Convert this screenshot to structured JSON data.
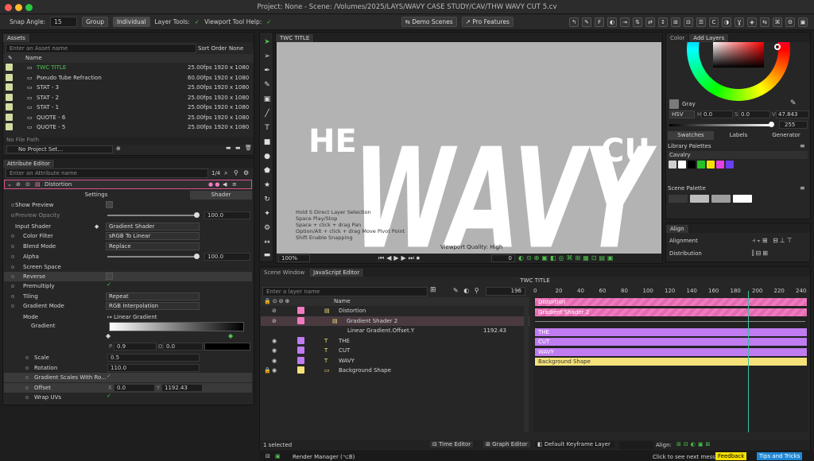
{
  "window": {
    "title": "Project: None - Scene: /Volumes/2025/LAYS/WAVY CASE STUDY/CAV/THW WAVY CUT 5.cv"
  },
  "toolbar": {
    "snap_label": "Snap Angle:",
    "snap_value": "15",
    "group": "Group",
    "individual": "Individual",
    "layer_tools": "Layer Tools:",
    "viewport_help": "Viewport Tool Help:",
    "demo_scenes": "Demo Scenes",
    "pro_features": "Pro Features"
  },
  "assets": {
    "tab": "Assets",
    "search_placeholder": "Enter an Asset name",
    "sort_label": "Sort Order",
    "sort_value": "None",
    "col_name": "Name",
    "items": [
      {
        "name": "TWC TITLE",
        "fps": "25.00fps",
        "res": "1920 x 1080"
      },
      {
        "name": "Pseudo Tube Refraction",
        "fps": "60.00fps",
        "res": "1920 x 1080"
      },
      {
        "name": "STAT - 3",
        "fps": "25.00fps",
        "res": "1920 x 1080"
      },
      {
        "name": "STAT - 2",
        "fps": "25.00fps",
        "res": "1920 x 1080"
      },
      {
        "name": "STAT - 1",
        "fps": "25.00fps",
        "res": "1920 x 1080"
      },
      {
        "name": "QUOTE - 6",
        "fps": "25.00fps",
        "res": "1920 x 1080"
      },
      {
        "name": "QUOTE - 5",
        "fps": "25.00fps",
        "res": "1920 x 1080"
      }
    ],
    "file_path": "No File Path",
    "project": "No Project Set..."
  },
  "attr": {
    "tab": "Attribute Editor",
    "search_placeholder": "Enter an Attribute name",
    "page": "1/4",
    "layer": "Distortion",
    "settings_tab": "Settings",
    "shader_tab": "Shader",
    "show_preview": "Show Preview",
    "preview_opacity": "Preview Opacity",
    "preview_opacity_val": "100.0",
    "input_shader": "Input Shader",
    "input_shader_val": "Gradient Shader",
    "color_filter": "Color Filter",
    "color_filter_val": "sRGB To Linear",
    "blend_mode": "Blend Mode",
    "blend_mode_val": "Replace",
    "alpha": "Alpha",
    "alpha_val": "100.0",
    "screen_space": "Screen Space",
    "reverse": "Reverse",
    "premultiply": "Premultiply",
    "tiling": "Tiling",
    "tiling_val": "Repeat",
    "gradient_mode": "Gradient Mode",
    "gradient_mode_val": "RGB Interpolation",
    "mode": "Mode",
    "mode_val": "Linear Gradient",
    "gradient": "Gradient",
    "p_label": "P",
    "p_val": "0.9",
    "o_label": "O",
    "o_val": "0.0",
    "scale": "Scale",
    "scale_val": "0.5",
    "rotation": "Rotation",
    "rotation_val": "110.0",
    "scales_with_ro": "Gradient Scales With Ro...",
    "offset": "Offset",
    "offset_x": "0.0",
    "offset_y": "1192.43",
    "wrap_uvs": "Wrap UVs",
    "x_label": "X",
    "y_label": "Y"
  },
  "viewport": {
    "tab": "TWC TITLE",
    "hint1": "Hold S Direct Layer Selection",
    "hint2": "Space Play/Stop",
    "hint3": "Space + click + drag Pan",
    "hint4": "Option/Alt + click + drag Move Pivot Point",
    "hint5": "Shift Enable Snapping",
    "quality": "Viewport Quality: High",
    "zoom": "100%",
    "frame": "0",
    "art_the": "HE",
    "art_wavy": "WAVY",
    "art_cut": "CU"
  },
  "color": {
    "tab_color": "Color",
    "tab_layers": "Add Layers",
    "name": "Gray",
    "mode": "HSV",
    "h": "0.0",
    "s": "0.0",
    "v": "47.843",
    "alpha": "255",
    "h_label": "H",
    "s_label": "S",
    "v_label": "V",
    "swatches": "Swatches",
    "labels": "Labels",
    "generator": "Generator",
    "library": "Library Palettes",
    "cavalry": "Cavalry",
    "scene_palette": "Scene Palette",
    "lib_colors": [
      "#cfcfcf",
      "#ffffff",
      "#000000",
      "#25c225",
      "#f5e000",
      "#e83fe0",
      "#6a3ff0"
    ],
    "scene_colors": [
      "#3a3a3a",
      "#bdbdbd",
      "#9e9e9e",
      "#ffffff"
    ]
  },
  "align": {
    "tab": "Align",
    "alignment": "Alignment",
    "distribution": "Distribution"
  },
  "scene": {
    "tab_scene": "Scene Window",
    "tab_js": "JavaScript Editor",
    "title": "TWC TITLE",
    "search_placeholder": "Enter a layer name",
    "frame": "196",
    "col_name": "Name",
    "layers": [
      {
        "name": "Distortion",
        "color": "#f07ac0"
      },
      {
        "name": "Gradient Shader 2",
        "color": "#f07ac0"
      },
      {
        "name": "Linear Gradient.Offset.Y",
        "value": "1192.43"
      },
      {
        "name": "THE",
        "color": "#c07cf0"
      },
      {
        "name": "CUT",
        "color": "#c07cf0"
      },
      {
        "name": "WAVY",
        "color": "#c07cf0"
      },
      {
        "name": "Background Shape",
        "color": "#f5e27a"
      }
    ],
    "ruler": [
      "0",
      "20",
      "40",
      "60",
      "80",
      "100",
      "120",
      "140",
      "160",
      "180",
      "200",
      "220",
      "240"
    ],
    "selected": "1 selected",
    "time_editor": "Time Editor",
    "graph_editor": "Graph Editor",
    "keyframe_layer": "Default Keyframe Layer",
    "align": "Align:",
    "render": "Render Manager (⌥B)",
    "msg": "Click to see next message",
    "feedback": "Feedback",
    "tips": "Tips and Tricks"
  }
}
